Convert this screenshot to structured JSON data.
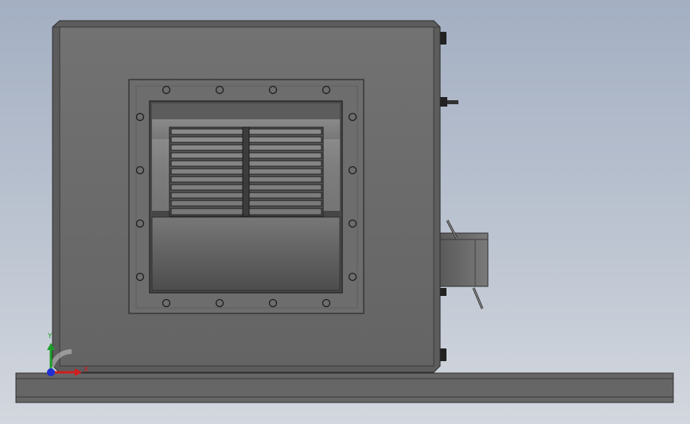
{
  "viewport": {
    "colors": {
      "background_top": "#a3afc2",
      "background_bottom": "#d3d7de",
      "housing": "#6b6b6b",
      "housing_edge": "#3a3a3a",
      "duct": "#5e5e5e",
      "base_rail": "#666666"
    }
  },
  "triad": {
    "y_label": "Y",
    "x_label": "X",
    "colors": {
      "x": "#d11f1f",
      "y": "#1d9e2a",
      "z": "#1f2fd1"
    }
  }
}
